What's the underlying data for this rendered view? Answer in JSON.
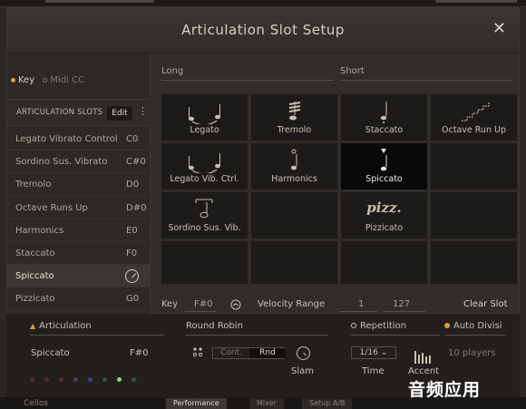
{
  "dialog": {
    "title": "Articulation Slot Setup",
    "close_glyph": "✕"
  },
  "left": {
    "tabs": [
      {
        "label": "Key",
        "active": true
      },
      {
        "label": "Midi CC",
        "active": false
      }
    ],
    "slots_header": "ARTICULATION SLOTS",
    "edit_label": "Edit",
    "more_glyph": "⋮",
    "slots": [
      {
        "name": "Legato Vibrato Control",
        "key": "C0"
      },
      {
        "name": "Sordino Sus. Vibrato",
        "key": "C#0"
      },
      {
        "name": "Tremolo",
        "key": "D0"
      },
      {
        "name": "Octave Runs Up",
        "key": "D#0"
      },
      {
        "name": "Harmonics",
        "key": "E0"
      },
      {
        "name": "Staccato",
        "key": "F0"
      },
      {
        "name": "Spiccato",
        "key": "",
        "selected": true
      },
      {
        "name": "Pizzicato",
        "key": "G0"
      }
    ]
  },
  "right": {
    "long_header": "Long",
    "short_header": "Short",
    "cells": [
      {
        "label": "Legato",
        "icon": "legato-icon"
      },
      {
        "label": "Tremolo",
        "icon": "tremolo-icon"
      },
      {
        "label": "Staccato",
        "icon": "staccato-icon"
      },
      {
        "label": "Octave Run Up",
        "icon": "run-up-icon"
      },
      {
        "label": "Legato Vib. Ctrl.",
        "icon": "legato-icon"
      },
      {
        "label": "Harmonics",
        "icon": "harmonics-icon"
      },
      {
        "label": "Spiccato",
        "icon": "spiccato-icon",
        "selected": true
      },
      {
        "label": "",
        "icon": ""
      },
      {
        "label": "Sordino Sus. Vib.",
        "icon": "sordino-icon"
      },
      {
        "label": "",
        "icon": ""
      },
      {
        "label": "Pizzicato",
        "icon": "pizzicato-text",
        "text": "pizz."
      },
      {
        "label": "",
        "icon": ""
      },
      {
        "label": "",
        "icon": ""
      },
      {
        "label": "",
        "icon": ""
      },
      {
        "label": "",
        "icon": ""
      },
      {
        "label": "",
        "icon": ""
      }
    ],
    "bottom": {
      "key_label": "Key",
      "key_value": "F#0",
      "velocity_label": "Velocity Range",
      "velocity_min": "1",
      "velocity_max": "127",
      "clear_label": "Clear Slot"
    }
  },
  "panel": {
    "articulation_header": "Articulation",
    "articulation_name": "Spiccato",
    "articulation_key": "F#0",
    "dot_colors": [
      "#5a2a2e",
      "#5a2a2e",
      "#5a2a2e",
      "#4d3a6a",
      "#3a4a7a",
      "#2e5a3a",
      "#7ee06a",
      "#2e5a3a"
    ],
    "round_robin_header": "Round Robin",
    "rr_off": "Cont.",
    "rr_on": "Rnd",
    "slam_label": "Slam",
    "repetition_header": "Repetition",
    "time_value": "1/16",
    "time_label": "Time",
    "accent_label": "Accent",
    "auto_divisi_header": "Auto Divisi",
    "players": "10 players"
  },
  "footer": {
    "instrument": "Cellos",
    "tabs": [
      "Performance",
      "Mixer",
      "Setup A/B"
    ]
  },
  "watermark": "音频应用"
}
